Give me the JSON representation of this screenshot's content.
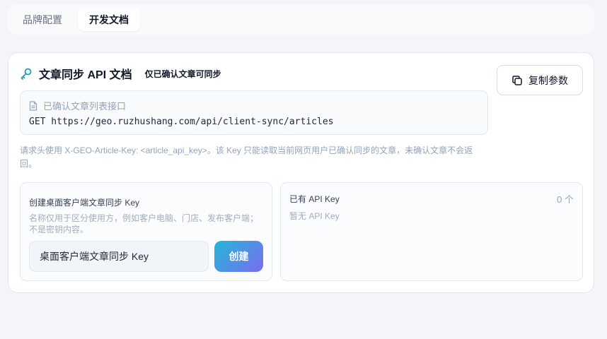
{
  "tabs": [
    {
      "label": "品牌配置",
      "active": false
    },
    {
      "label": "开发文档",
      "active": true
    }
  ],
  "card": {
    "title": "文章同步 API 文档",
    "subtitle": "仅已确认文章可同步",
    "copy_label": "复制参数",
    "endpoint_label": "已确认文章列表接口",
    "endpoint_url": "GET https://geo.ruzhushang.com/api/client-sync/articles",
    "note": "请求头使用 X-GEO-Article-Key: <article_api_key>。该 Key 只能读取当前网页用户已确认同步的文章，未确认文章不会返回。"
  },
  "create": {
    "title": "创建桌面客户端文章同步 Key",
    "hint": "名称仅用于区分使用方，例如客户电脑、门店、发布客户端；不是密钥内容。",
    "input_value": "桌面客户端文章同步 Key",
    "button_label": "创建"
  },
  "keys": {
    "title": "已有 API Key",
    "count": "0 个",
    "empty": "暂无 API Key"
  },
  "colors": {
    "accent_gradient_start": "#22b8d8",
    "accent_gradient_end": "#7b6cf0",
    "icon_teal": "#17a2b8"
  },
  "icons": {
    "title": "key-icon",
    "copy": "copy-icon",
    "endpoint": "document-icon"
  }
}
